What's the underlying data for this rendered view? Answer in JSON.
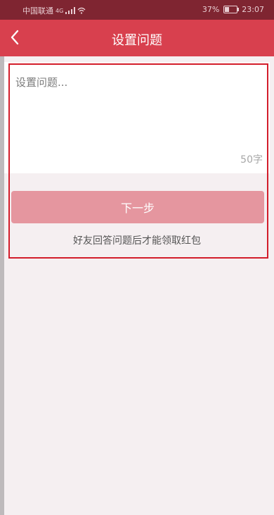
{
  "status_bar": {
    "carrier": "中国联通",
    "network": "4G",
    "battery": "37%",
    "battery_level": 0.37,
    "time": "23:07"
  },
  "nav": {
    "title": "设置问题",
    "back_icon": "chevron-left-icon"
  },
  "question": {
    "placeholder": "设置问题...",
    "value": "",
    "counter": "50字"
  },
  "actions": {
    "next_label": "下一步"
  },
  "hint": {
    "text": "好友回答问题后才能领取红包"
  },
  "colors": {
    "status_bar_bg": "#7f2531",
    "nav_bg": "#d8404e",
    "button_bg": "#e5969f",
    "highlight_border": "#d31d2b",
    "page_bg": "#f5eff1"
  }
}
